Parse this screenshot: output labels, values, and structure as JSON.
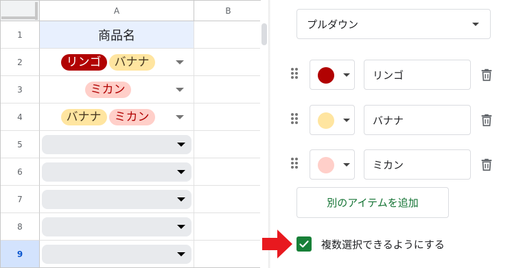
{
  "sheet": {
    "columns": [
      {
        "label": "A"
      },
      {
        "label": "B"
      }
    ],
    "rows": [
      {
        "num": "1",
        "type": "header",
        "text": "商品名"
      },
      {
        "num": "2",
        "type": "chips",
        "chips": [
          {
            "text": "リンゴ",
            "kind": "apple"
          },
          {
            "text": "バナナ",
            "kind": "banana"
          }
        ]
      },
      {
        "num": "3",
        "type": "chips",
        "chips": [
          {
            "text": "ミカン",
            "kind": "mikan"
          }
        ]
      },
      {
        "num": "4",
        "type": "chips",
        "chips": [
          {
            "text": "バナナ",
            "kind": "banana"
          },
          {
            "text": "ミカン",
            "kind": "mikan"
          }
        ]
      },
      {
        "num": "5",
        "type": "empty"
      },
      {
        "num": "6",
        "type": "empty"
      },
      {
        "num": "7",
        "type": "empty"
      },
      {
        "num": "8",
        "type": "empty"
      },
      {
        "num": "9",
        "type": "empty",
        "selected": true
      }
    ]
  },
  "panel": {
    "style_select": "プルダウン",
    "items": [
      {
        "value": "リンゴ",
        "color": "#b10202"
      },
      {
        "value": "バナナ",
        "color": "#ffe5a0"
      },
      {
        "value": "ミカン",
        "color": "#ffcfc9"
      }
    ],
    "add_item_label": "別のアイテムを追加",
    "multi_select_label": "複数選択できるようにする",
    "multi_select_checked": true
  },
  "colors": {
    "apple": "#b10202",
    "banana": "#ffe5a0",
    "mikan": "#ffcfc9",
    "accent_green": "#188038",
    "arrow_red": "#e8191f"
  },
  "icons": {
    "drag": "drag-handle-icon",
    "trash": "trash-icon",
    "check": "check-icon",
    "arrow": "red-arrow-icon"
  }
}
